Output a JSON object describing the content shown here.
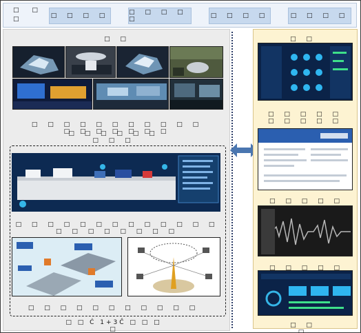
{
  "header": {
    "title": "□ □\n□",
    "tabs": [
      {
        "label": "□ □ □ □"
      },
      {
        "label": "□ □ □ □ □"
      },
      {
        "label": "□ □ □ □"
      },
      {
        "label": "□ □ □ □"
      }
    ]
  },
  "left": {
    "top_label": "□ □",
    "photos_caption_1": "□ □ □ □ □ □ □ □ □ □ □ □ □ □ □ □ □ □",
    "photos_caption_2": "□ □ □ □ □ □ □ □ □",
    "line_caption": "□ □ □ □ □ □ □ □ □ □ □ □ □ □ □ □ □ □ □ □ □",
    "bottom_caption": "□ □ □ □ □ □ □ □ □ □ □",
    "footer_prefix": "□ □ Ć 1+3Ĉ □ □ □ □"
  },
  "right": {
    "top_label": "□ □",
    "caption_2": "□ □ □ □ □ □ □ □ □ □",
    "caption_3": "□ □ □ □ □ □ □",
    "caption_4": "□ □ □ □ □ □ □ □",
    "caption_5": "□ □ □"
  },
  "colors": {
    "header_bg": "#eef3fa",
    "tab_bg": "#c7d9ee",
    "left_panel_bg": "#ececec",
    "right_panel_bg": "#fdf3d2",
    "arrow": "#4a76b0",
    "dashboard_bg": "#0d2a52"
  }
}
